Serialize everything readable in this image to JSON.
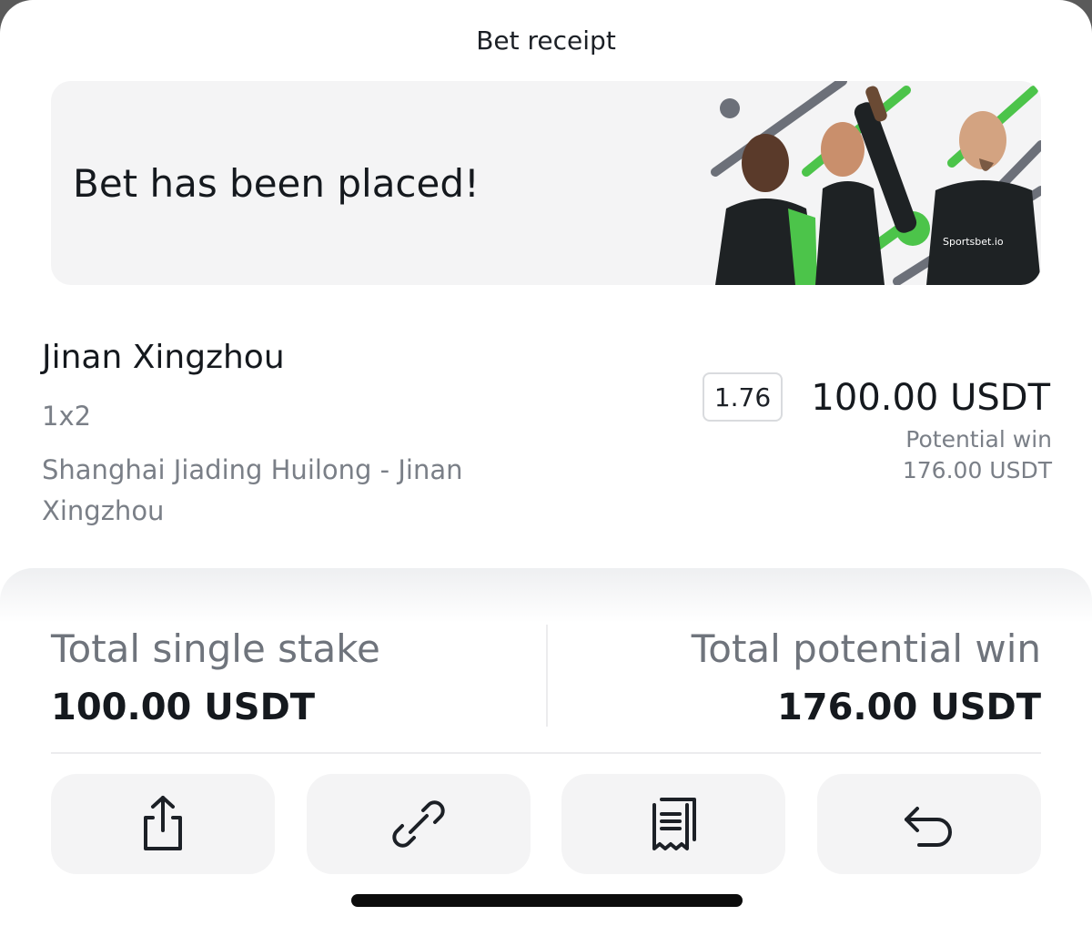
{
  "header": {
    "title": "Bet receipt"
  },
  "banner": {
    "message": "Bet has been placed!",
    "brand_text": "Sportsbet.io",
    "accent_color": "#4cc44a"
  },
  "bet": {
    "selection": "Jinan Xingzhou",
    "market": "1x2",
    "event": "Shanghai Jiading Huilong - Jinan Xingzhou",
    "odds": "1.76",
    "stake": "100.00 USDT",
    "potential_win_label": "Potential win",
    "potential_win_value": "176.00 USDT"
  },
  "totals": {
    "stake_label": "Total single stake",
    "stake_value": "100.00 USDT",
    "win_label": "Total potential win",
    "win_value": "176.00 USDT"
  },
  "actions": [
    {
      "icon": "share-icon"
    },
    {
      "icon": "link-icon"
    },
    {
      "icon": "receipt-icon"
    },
    {
      "icon": "undo-icon"
    }
  ]
}
